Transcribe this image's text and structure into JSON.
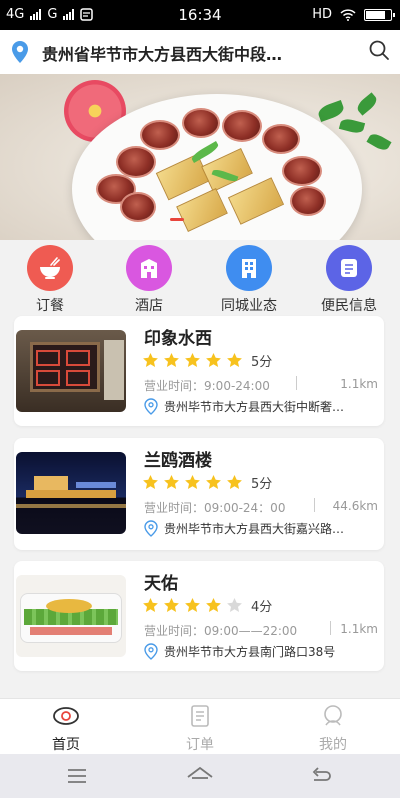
{
  "status_bar": {
    "network_1": "4G",
    "network_2": "G",
    "time": "16:34",
    "hd": "HD",
    "battery_level": 0.85
  },
  "header": {
    "address": "贵州省毕节市大方县西大街中段…",
    "location_icon": "location-pin-icon",
    "search_icon": "search-icon"
  },
  "categories": [
    {
      "label": "订餐",
      "icon": "food-bowl-icon",
      "color": "#ef5b52"
    },
    {
      "label": "酒店",
      "icon": "hotel-icon",
      "color": "#d957e0"
    },
    {
      "label": "同城业态",
      "icon": "building-icon",
      "color": "#3f8df0"
    },
    {
      "label": "便民信息",
      "icon": "info-card-icon",
      "color": "#5c64e6"
    }
  ],
  "restaurants": [
    {
      "name": "印象水西",
      "rating": 5,
      "score_text": "5分",
      "hours": "营业时间：9:00-24:00",
      "distance": "1.1km",
      "address": "贵州毕节市大方县西大街中断奢…"
    },
    {
      "name": "兰鸥酒楼",
      "rating": 5,
      "score_text": "5分",
      "hours": "营业时间：09:00-24：00",
      "distance": "44.6km",
      "address": "贵州毕节市大方县西大街嘉兴路…"
    },
    {
      "name": "天佑",
      "rating": 4,
      "score_text": "4分",
      "hours": "营业时间：09:00——22:00",
      "distance": "1.1km",
      "address": "贵州毕节市大方县南门路口38号"
    }
  ],
  "tabs": [
    {
      "label": "首页",
      "icon": "eye-icon",
      "active": true
    },
    {
      "label": "订单",
      "icon": "document-icon",
      "active": false
    },
    {
      "label": "我的",
      "icon": "person-icon",
      "active": false
    }
  ],
  "colors": {
    "star_active": "#f7c21e",
    "star_inactive": "#d9d9d9",
    "accent_blue": "#4a9be8"
  }
}
